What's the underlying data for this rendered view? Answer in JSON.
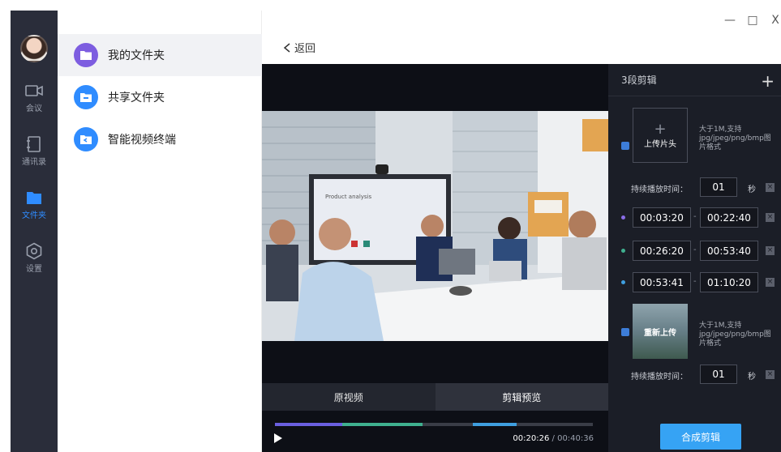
{
  "window": {
    "minimize": "—",
    "maximize": "□",
    "close": "X"
  },
  "rail": {
    "items": [
      {
        "label": "会议",
        "icon": "video-camera-icon"
      },
      {
        "label": "通讯录",
        "icon": "address-book-icon"
      },
      {
        "label": "文件夹",
        "icon": "folder-icon"
      },
      {
        "label": "设置",
        "icon": "gear-icon"
      }
    ],
    "active_color": "#2f8cff"
  },
  "folders": {
    "items": [
      {
        "name": "我的文件夹",
        "color": "#7d5de0"
      },
      {
        "name": "共享文件夹",
        "color": "#2f8cff"
      },
      {
        "name": "智能视频终端",
        "color": "#2f8cff"
      }
    ]
  },
  "main": {
    "back_label": "返回"
  },
  "player": {
    "tabs": [
      "原视频",
      "剪辑预览"
    ],
    "current_time": "00:20:26",
    "separator": " / ",
    "total_time": "00:40:36",
    "segments": [
      {
        "color": "#6a5fe0"
      },
      {
        "color": "#3fb08f"
      },
      {
        "color": "#3f9fe0"
      }
    ],
    "video": {
      "screen_text": "Product analysis"
    }
  },
  "edit": {
    "header": "3段剪辑",
    "header_plus": "+",
    "intro": {
      "upload_plus": "+",
      "upload_label": "上传片头",
      "hint": "大于1M,支持jpg/jpeg/png/bmp图片格式",
      "duration_label": "持续播放时间：",
      "duration_value": "01",
      "unit": "秒"
    },
    "clips": [
      {
        "start": "00:03:20",
        "end": "00:22:40",
        "color": "#8a6de8"
      },
      {
        "start": "00:26:20",
        "end": "00:53:40",
        "color": "#3fb08f"
      },
      {
        "start": "00:53:41",
        "end": "01:10:20",
        "color": "#3f9fe0"
      }
    ],
    "outro": {
      "reupload_label": "重新上传",
      "hint": "大于1M,支持jpg/jpeg/png/bmp图片格式",
      "duration_label": "持续播放时间：",
      "duration_value": "01",
      "unit": "秒"
    },
    "compose_label": "合成剪辑",
    "remove_symbol": "×",
    "range_dash": "-"
  }
}
